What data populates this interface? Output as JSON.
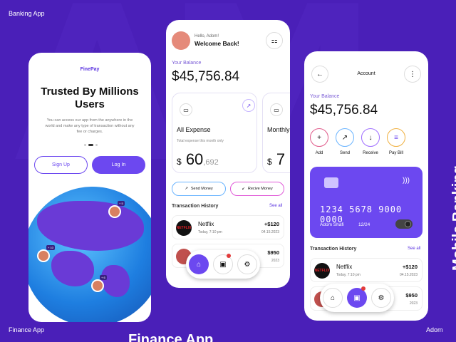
{
  "labels": {
    "top_left": "Banking App",
    "bottom_left": "Finance App",
    "bottom_right": "Adom",
    "vertical": "Mobile Banking",
    "big_bottom": "Finance App"
  },
  "phone1": {
    "brand": "FinePay",
    "title": "Trusted By Millions Users",
    "description": "You can access our app from the anywhere in the world and make any type of transaction without any fee or charges.",
    "signup": "Sign Up",
    "login": "Log In"
  },
  "phone2": {
    "hello": "Hello, Adom!",
    "welcome": "Welcome Back!",
    "balance_label": "Your Balance",
    "balance": "$45,756.84",
    "card_title": "All Expense",
    "card_sub": "Total expense this month only",
    "card_amount_main": "60",
    "card_amount_cents": ",692",
    "card_currency": "$",
    "card2_title": "Monthly",
    "card2_amount": "7",
    "send_money": "Send Money",
    "receive_money": "Recive Money",
    "transaction_history": "Transaction History",
    "see_all": "See all",
    "tx": [
      {
        "name": "Netflix",
        "date": "Today, 7:10 pm",
        "amount": "+$120",
        "day": "04.15.2023"
      },
      {
        "amount": "$950",
        "day": "2023"
      }
    ]
  },
  "phone3": {
    "header": "Account",
    "balance_label": "Your Balance",
    "balance": "$45,756.84",
    "actions": [
      {
        "label": "Add",
        "icon": "plus-icon"
      },
      {
        "label": "Send",
        "icon": "arrow-up-right-icon"
      },
      {
        "label": "Receive",
        "icon": "arrow-down-icon"
      },
      {
        "label": "Pay Bill",
        "icon": "bill-icon"
      }
    ],
    "card_number": "1234 5678 9000 0000",
    "card_name": "Adom Shafi",
    "card_exp": "12/24",
    "transaction_history": "Transaction History",
    "see_all": "See all",
    "tx": [
      {
        "name": "Netflix",
        "date": "Today, 7:10 pm",
        "amount": "+$120",
        "day": "04.15.2023"
      },
      {
        "amount": "$950",
        "day": "2023"
      }
    ]
  },
  "colors": {
    "background": "#4a1fb8",
    "accent": "#6c48f0"
  }
}
